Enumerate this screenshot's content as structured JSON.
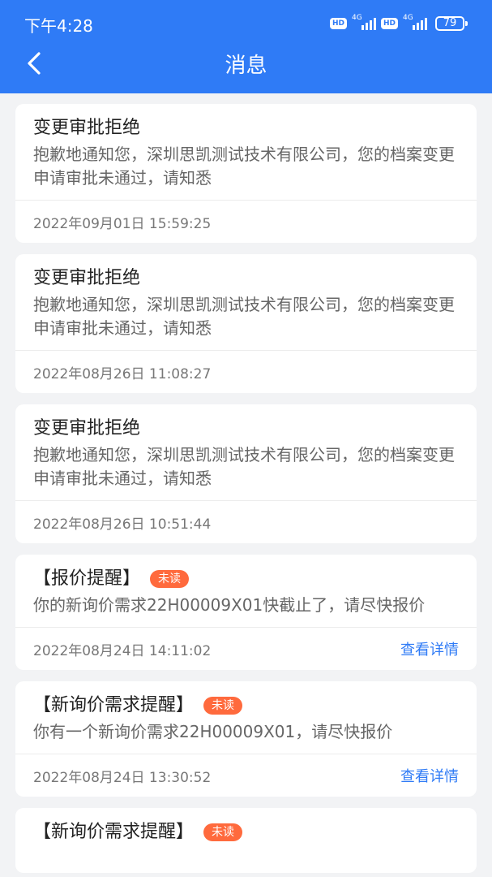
{
  "status_bar": {
    "time": "下午4:28",
    "hd_label": "HD",
    "network_label": "4G",
    "battery": "79"
  },
  "header": {
    "title": "消息",
    "back_icon": "chevron-left-icon"
  },
  "colors": {
    "header_bg": "#2f7bf6",
    "badge_bg": "#ff6a3d",
    "link": "#2f7bf6"
  },
  "messages": [
    {
      "title": "变更审批拒绝",
      "body": "抱歉地通知您，深圳思凯测试技术有限公司，您的档案变更申请审批未通过，请知悉",
      "time": "2022年09月01日 15:59:25"
    },
    {
      "title": "变更审批拒绝",
      "body": "抱歉地通知您，深圳思凯测试技术有限公司，您的档案变更申请审批未通过，请知悉",
      "time": "2022年08月26日 11:08:27"
    },
    {
      "title": "变更审批拒绝",
      "body": "抱歉地通知您，深圳思凯测试技术有限公司，您的档案变更申请审批未通过，请知悉",
      "time": "2022年08月26日 10:51:44"
    },
    {
      "title": "【报价提醒】",
      "badge": "未读",
      "body": "你的新询价需求22H00009X01快截止了，请尽快报价",
      "time": "2022年08月24日 14:11:02",
      "link": "查看详情"
    },
    {
      "title": "【新询价需求提醒】",
      "badge": "未读",
      "body": "你有一个新询价需求22H00009X01，请尽快报价",
      "time": "2022年08月24日 13:30:52",
      "link": "查看详情"
    },
    {
      "title": "【新询价需求提醒】",
      "badge": "未读"
    }
  ]
}
